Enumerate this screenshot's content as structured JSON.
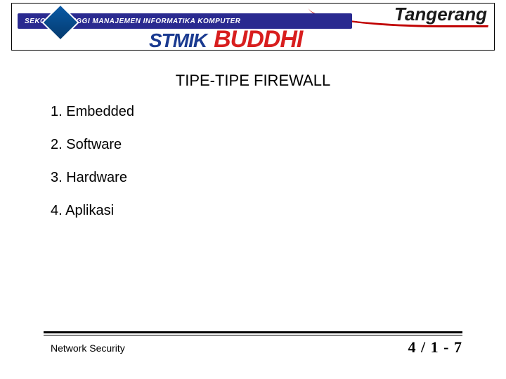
{
  "header": {
    "institution_line": "SEKOLAH TINGGI MANAJEMEN INFORMATIKA KOMPUTER",
    "city": "Tangerang",
    "acronym": "STMIK",
    "brand": "BUDDHI"
  },
  "title": "TIPE-TIPE FIREWALL",
  "items": [
    "1. Embedded",
    "2. Software",
    "3. Hardware",
    "4. Aplikasi"
  ],
  "footer": {
    "left": "Network Security",
    "right": "4 / 1 - 7"
  }
}
